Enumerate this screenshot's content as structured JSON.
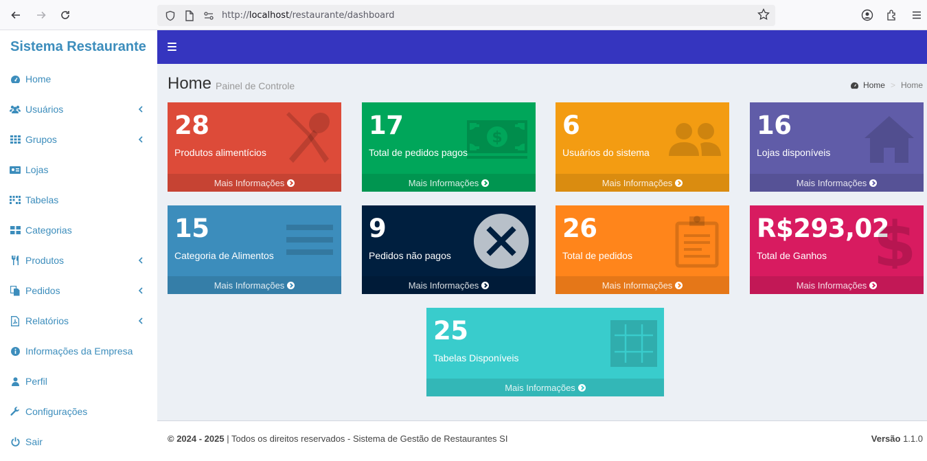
{
  "browser": {
    "url_prefix": "http://",
    "url_host": "localhost",
    "url_path": "/restaurante/dashboard"
  },
  "sidebar": {
    "brand": "Sistema Restaurante",
    "items": [
      {
        "label": "Home",
        "icon": "dashboard-icon",
        "has_submenu": false
      },
      {
        "label": "Usuários",
        "icon": "users-icon",
        "has_submenu": true
      },
      {
        "label": "Grupos",
        "icon": "grid-icon",
        "has_submenu": true
      },
      {
        "label": "Lojas",
        "icon": "store-icon",
        "has_submenu": false
      },
      {
        "label": "Tabelas",
        "icon": "table-icon",
        "has_submenu": false
      },
      {
        "label": "Categorias",
        "icon": "categories-icon",
        "has_submenu": false
      },
      {
        "label": "Produtos",
        "icon": "cutlery-icon",
        "has_submenu": true
      },
      {
        "label": "Pedidos",
        "icon": "orders-icon",
        "has_submenu": true
      },
      {
        "label": "Relatórios",
        "icon": "pdf-icon",
        "has_submenu": true
      },
      {
        "label": "Informações da Empresa",
        "icon": "info-icon",
        "has_submenu": false
      },
      {
        "label": "Perfil",
        "icon": "user-icon",
        "has_submenu": false
      },
      {
        "label": "Configurações",
        "icon": "wrench-icon",
        "has_submenu": false
      },
      {
        "label": "Sair",
        "icon": "power-icon",
        "has_submenu": false
      }
    ]
  },
  "header": {
    "title": "Home",
    "subtitle": "Painel de Controle",
    "breadcrumb": [
      "Home",
      "Home"
    ]
  },
  "boxes": [
    {
      "value": "28",
      "label": "Produtos alimentícios",
      "footer": "Mais Informações",
      "color": "#dd4b39",
      "icon": "cutlery-icon"
    },
    {
      "value": "17",
      "label": "Total de pedidos pagos",
      "footer": "Mais Informações",
      "color": "#00a65a",
      "icon": "money-icon"
    },
    {
      "value": "6",
      "label": "Usuários do sistema",
      "footer": "Mais Informações",
      "color": "#f39c12",
      "icon": "users-icon"
    },
    {
      "value": "16",
      "label": "Lojas disponíveis",
      "footer": "Mais Informações",
      "color": "#605ca8",
      "icon": "home-icon"
    },
    {
      "value": "15",
      "label": "Categoria de Alimentos",
      "footer": "Mais Informações",
      "color": "#3c8dbc",
      "icon": "list-icon"
    },
    {
      "value": "9",
      "label": "Pedidos não pagos",
      "footer": "Mais Informações",
      "color": "#001f3f",
      "icon": "close-icon"
    },
    {
      "value": "26",
      "label": "Total de pedidos",
      "footer": "Mais Informações",
      "color": "#ff851b",
      "icon": "clipboard-icon"
    },
    {
      "value": "R$293,02",
      "label": "Total de Ganhos",
      "footer": "Mais Informações",
      "color": "#d81b60",
      "icon": "dollar-icon"
    },
    {
      "value": "25",
      "label": "Tabelas Disponíveis",
      "footer": "Mais Informações",
      "color": "#39cccc",
      "icon": "table-grid-icon"
    }
  ],
  "footer": {
    "copyright": "© 2024 - 2025",
    "rights": " | Todos os direitos reservados - Sistema de Gestão de Restaurantes SI",
    "version_label": "Versão",
    "version": "1.1.0"
  }
}
